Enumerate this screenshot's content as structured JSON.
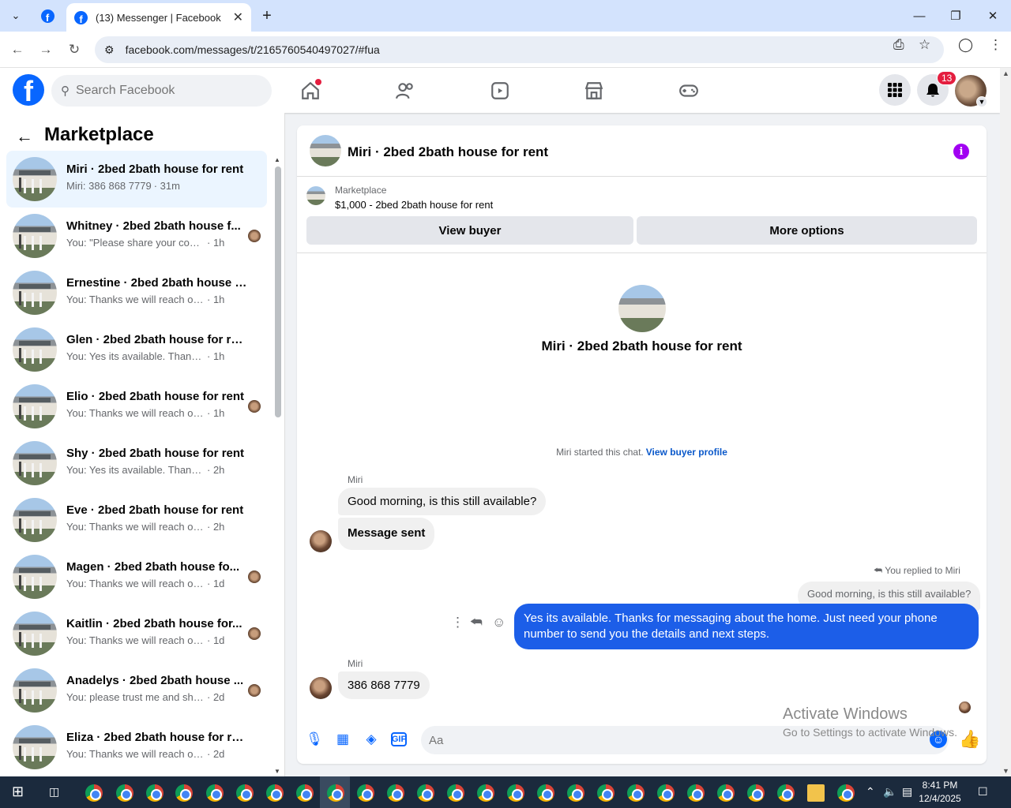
{
  "browser": {
    "tab_title": "(13) Messenger | Facebook",
    "url": "facebook.com/messages/t/2165760540497027/#fua"
  },
  "header": {
    "search_placeholder": "Search Facebook",
    "notification_count": "13"
  },
  "sidebar": {
    "title": "Marketplace",
    "conversations": [
      {
        "name": "Miri · 2bed 2bath house for rent",
        "snippet": "Miri: 386 868 7779",
        "time": "· 31m",
        "active": true
      },
      {
        "name": "Whitney · 2bed 2bath house f...",
        "snippet": "You: \"Please share your contact ...",
        "time": "· 1h"
      },
      {
        "name": "Ernestine · 2bed 2bath house fo...",
        "snippet": "You: Thanks we will reach out to yo...",
        "time": "· 1h"
      },
      {
        "name": "Glen · 2bed 2bath house for rent",
        "snippet": "You: Yes its available. Thanks for me...",
        "time": "· 1h"
      },
      {
        "name": "Elio · 2bed 2bath house for rent",
        "snippet": "You: Thanks we will reach out to ...",
        "time": "· 1h"
      },
      {
        "name": "Shy · 2bed 2bath house for rent",
        "snippet": "You: Yes its available. Thanks for me...",
        "time": "· 2h"
      },
      {
        "name": "Eve · 2bed 2bath house for rent",
        "snippet": "You: Thanks we will reach out to yo...",
        "time": "· 2h"
      },
      {
        "name": "Magen · 2bed 2bath house fo...",
        "snippet": "You: Thanks we will reach out to...",
        "time": "· 1d"
      },
      {
        "name": "Kaitlin · 2bed 2bath house for...",
        "snippet": "You: Thanks we will reach out to...",
        "time": "· 1d"
      },
      {
        "name": "Anadelys · 2bed 2bath house ...",
        "snippet": "You: please trust me and share y...",
        "time": "· 2d"
      },
      {
        "name": "Eliza · 2bed 2bath house for rent",
        "snippet": "You: Thanks we will reach out to yo...",
        "time": "· 2d"
      }
    ]
  },
  "chat": {
    "title": "Miri · 2bed 2bath house for rent",
    "listing_label": "Marketplace",
    "listing_price": "$1,000 - 2bed 2bath house for rent",
    "view_buyer": "View buyer",
    "more_options": "More options",
    "hero_name": "Miri · 2bed 2bath house for rent",
    "started_text": "Miri started this chat.",
    "view_buyer_profile": "View buyer profile",
    "sender": "Miri",
    "msg1": "Good morning, is this still available?",
    "msg2": "Message sent",
    "replied_label": "You replied to Miri",
    "quoted": "Good morning, is this still available?",
    "reply": "Yes its available. Thanks for messaging about the home. Just need your phone number to send you the details and next steps.",
    "sender2": "Miri",
    "msg3": "386 868 7779",
    "input_placeholder": "Aa"
  },
  "watermark": {
    "line1": "Activate Windows",
    "line2": "Go to Settings to activate Windows."
  },
  "taskbar": {
    "time": "8:41 PM",
    "date": "12/4/2025"
  },
  "colors": {
    "fb_blue": "#0866ff",
    "bubble_out": "#1c5ee8",
    "info": "#a100f2",
    "badge": "#e41e3f"
  }
}
